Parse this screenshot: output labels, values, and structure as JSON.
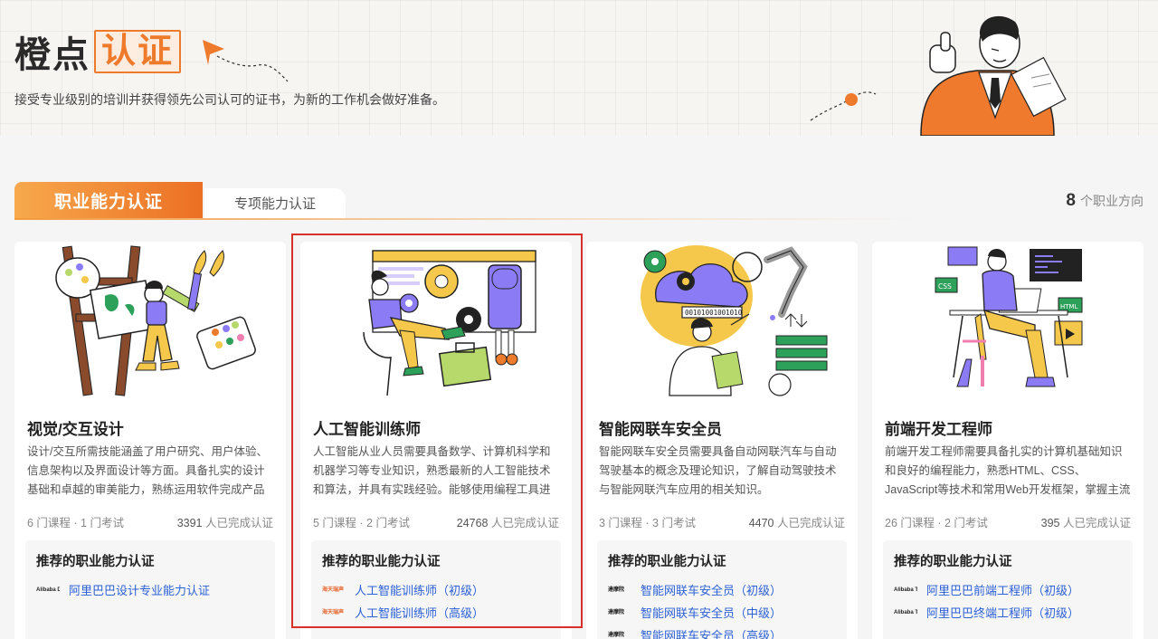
{
  "hero": {
    "title_part1": "橙点",
    "title_part2": "认证",
    "subtitle": "接受专业级别的培训并获得领先公司认可的证书，为新的工作机会做好准备。"
  },
  "tabs": [
    {
      "label": "职业能力认证",
      "active": true
    },
    {
      "label": "专项能力认证",
      "active": false
    }
  ],
  "career_count": {
    "number": "8",
    "suffix": "个职业方向"
  },
  "rec_heading": "推荐的职业能力认证",
  "cards": [
    {
      "title": "视觉/交互设计",
      "desc": "设计/交互所需技能涵盖了用户研究、用户体验、信息架构以及界面设计等方面。具备扎实的设计基础和卓越的审美能力，熟练运用软件完成产品设...",
      "courses": "6 门课程 · 1 门考试",
      "learners_num": "3391",
      "learners_suffix": " 人已完成认证",
      "recs": [
        {
          "logo": "Alibaba Design",
          "label": "阿里巴巴设计专业能力认证"
        }
      ]
    },
    {
      "title": "人工智能训练师",
      "desc": "人工智能从业人员需要具备数学、计算机科学和机器学习等专业知识，熟悉最新的人工智能技术和算法，并具有实践经验。能够使用编程工具进行模...",
      "courses": "5 门课程 · 2 门考试",
      "learners_num": "24768",
      "learners_suffix": " 人已完成认证",
      "recs": [
        {
          "logo": "海天瑞声",
          "label": "人工智能训练师（初级）"
        },
        {
          "logo": "海天瑞声",
          "label": "人工智能训练师（高级）"
        }
      ]
    },
    {
      "title": "智能网联车安全员",
      "desc": "智能网联车安全员需要具备自动网联汽车与自动驾驶基本的概念及理论知识，了解自动驾驶技术与智能网联汽车应用的相关知识。",
      "courses": "3 门课程 · 3 门考试",
      "learners_num": "4470",
      "learners_suffix": " 人已完成认证",
      "recs": [
        {
          "logo": "達摩院",
          "label": "智能网联车安全员（初级）"
        },
        {
          "logo": "達摩院",
          "label": "智能网联车安全员（中级）"
        },
        {
          "logo": "達摩院",
          "label": "智能网联车安全员（高级）"
        }
      ]
    },
    {
      "title": "前端开发工程师",
      "desc": "前端开发工程师需要具备扎实的计算机基础知识和良好的编程能力，熟悉HTML、CSS、JavaScript等技术和常用Web开发框架，掌握主流前端框架...",
      "courses": "26 门课程 · 2 门考试",
      "learners_num": "395",
      "learners_suffix": " 人已完成认证",
      "recs": [
        {
          "logo": "Alibaba Tech",
          "label": "阿里巴巴前端工程师（初级）"
        },
        {
          "logo": "Alibaba Tech",
          "label": "阿里巴巴终端工程师（初级）"
        }
      ]
    }
  ],
  "illus_labels": {
    "binary": "00101001001010",
    "css": "CSS",
    "html": "HTML"
  },
  "colors": {
    "accent": "#ee7a2c",
    "link": "#2d61d6",
    "highlight": "#d9302c",
    "logo_haitian": "#e8632a",
    "logo_damo": "#222222",
    "logo_alibaba": "#ff6a00"
  },
  "selected_card": 1
}
